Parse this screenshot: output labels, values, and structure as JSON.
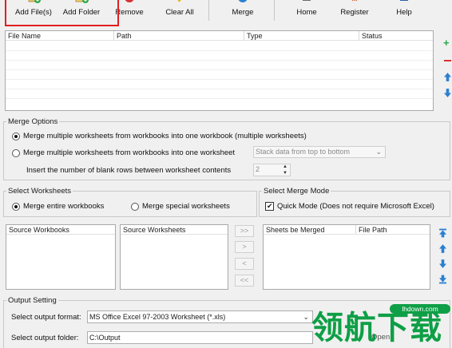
{
  "toolbar": {
    "add_files": "Add File(s)",
    "add_folder": "Add Folder",
    "remove": "Remove",
    "clear_all": "Clear All",
    "merge": "Merge",
    "home": "Home",
    "register": "Register",
    "help": "Help"
  },
  "file_list": {
    "columns": [
      "File Name",
      "Path",
      "Type",
      "Status"
    ]
  },
  "merge_options": {
    "title": "Merge Options",
    "opt1": "Merge multiple worksheets from workbooks into one workbook (multiple worksheets)",
    "opt2": "Merge multiple worksheets from workbooks into one worksheet",
    "stack_value": "Stack data from top to bottom",
    "blank_rows_label": "Insert the number of blank rows between worksheet contents",
    "blank_rows_value": "2"
  },
  "select_worksheets": {
    "title": "Select Worksheets",
    "opt_entire": "Merge entire workbooks",
    "opt_special": "Merge special worksheets"
  },
  "select_merge_mode": {
    "title": "Select Merge Mode",
    "quick_mode": "Quick Mode (Does not require Microsoft Excel)"
  },
  "lists": {
    "source_workbooks": "Source Workbooks",
    "source_worksheets": "Source Worksheets",
    "sheets_merged": "Sheets be Merged",
    "file_path": "File Path",
    "btn_add_all": ">>",
    "btn_add": ">",
    "btn_remove": "<",
    "btn_remove_all": "<<"
  },
  "output": {
    "title": "Output Setting",
    "format_label": "Select output format:",
    "format_value": "MS Office Excel 97-2003 Worksheet (*.xls)",
    "folder_label": "Select output folder:",
    "folder_value": "C:\\Output",
    "open_label": "Open"
  },
  "watermark": {
    "domain": "lhdown.com",
    "cn_text": "领航下载"
  },
  "colors": {
    "highlight_border": "#e02020",
    "accent_blue": "#2b7fd0",
    "add_green": "#2aa84a",
    "remove_red": "#d63232",
    "watermark_green": "#0e9f46"
  }
}
